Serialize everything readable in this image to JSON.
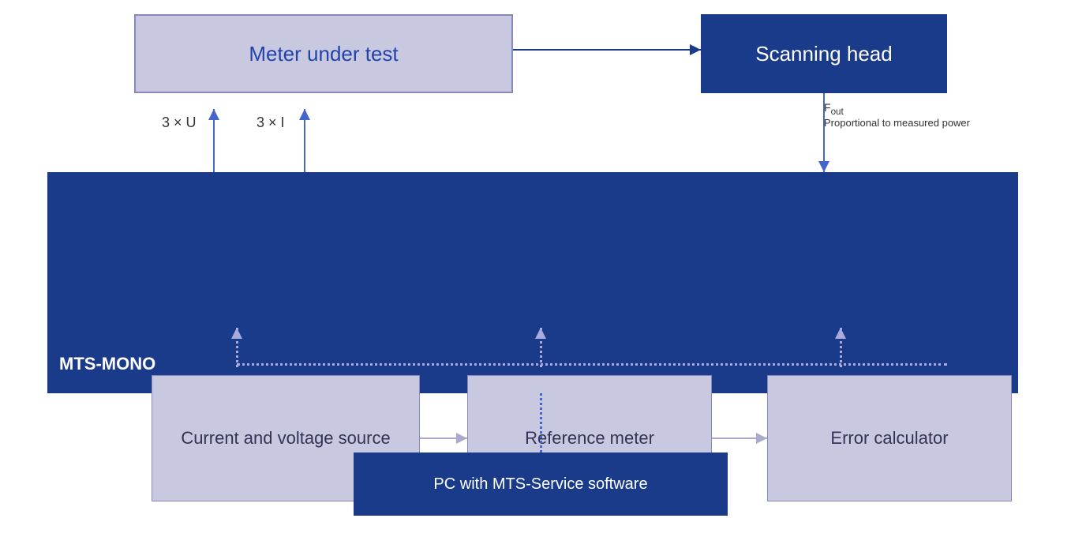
{
  "meter_under_test": {
    "label": "Meter under test"
  },
  "scanning_head": {
    "label": "Scanning head"
  },
  "fout": {
    "label": "F",
    "subscript": "out",
    "proportional": "Proportional to measured power"
  },
  "current_voltage": {
    "label": "Current and voltage source"
  },
  "reference_meter": {
    "label": "Reference meter"
  },
  "error_calculator": {
    "label": "Error calculator"
  },
  "label_3u": "3 × U",
  "label_3i": "3 × I",
  "mts_mono": "MTS-MONO",
  "pc": {
    "label": "PC with MTS-Service software"
  }
}
